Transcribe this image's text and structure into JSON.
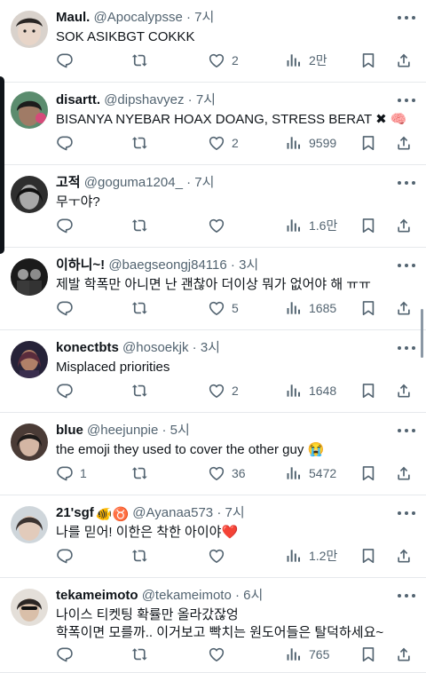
{
  "tweets": [
    {
      "name": "Maul.",
      "handle": "@Apocalypsse",
      "sep": "·",
      "time": "7시",
      "text": [
        "SOK ASIKBGT COKKK"
      ],
      "emoji": "",
      "counts": {
        "reply": "",
        "retweet": "",
        "like": "2",
        "views": "2만"
      }
    },
    {
      "name": "disartt.",
      "handle": "@dipshavyez",
      "sep": "·",
      "time": "7시",
      "text": [
        "BISANYA NYEBAR HOAX DOANG, STRESS BERAT ✖ 🧠"
      ],
      "emoji": "",
      "counts": {
        "reply": "",
        "retweet": "",
        "like": "2",
        "views": "9599"
      }
    },
    {
      "name": "고적",
      "handle": "@goguma1204_",
      "sep": "·",
      "time": "7시",
      "text": [
        "무ㅜ야?"
      ],
      "emoji": "",
      "counts": {
        "reply": "",
        "retweet": "",
        "like": "",
        "views": "1.6만"
      }
    },
    {
      "name": "이하니~!",
      "handle": "@baegseongj84116",
      "sep": "·",
      "time": "3시",
      "text": [
        "제발 학폭만 아니면 난 괜찮아 더이상 뭐가 없어야 해 ㅠㅠ"
      ],
      "emoji": "",
      "counts": {
        "reply": "",
        "retweet": "",
        "like": "5",
        "views": "1685"
      }
    },
    {
      "name": "konectbts",
      "handle": "@hosoekjk",
      "sep": "·",
      "time": "3시",
      "text": [
        "Misplaced priorities"
      ],
      "emoji": "",
      "counts": {
        "reply": "",
        "retweet": "",
        "like": "2",
        "views": "1648"
      }
    },
    {
      "name": "blue",
      "handle": "@heejunpie",
      "sep": "·",
      "time": "5시",
      "text": [
        "the emoji they used to cover the other guy 😭"
      ],
      "emoji": "",
      "counts": {
        "reply": "1",
        "retweet": "",
        "like": "36",
        "views": "5472"
      }
    },
    {
      "name": "21'sgf",
      "handle": "@Ayanaa573",
      "sep": "·",
      "time": "7시",
      "text": [
        "나를 믿어! 이한은 착한 아이야❤️"
      ],
      "emoji": "🐠♉",
      "counts": {
        "reply": "",
        "retweet": "",
        "like": "",
        "views": "1.2만"
      }
    },
    {
      "name": "tekameimoto",
      "handle": "@tekameimoto",
      "sep": "·",
      "time": "6시",
      "text": [
        "나이스 티켓팅 확률만 올라갔잖엉",
        "학폭이면 모를까.. 이거보고 빡치는 원도어들은 탈덕하세요~"
      ],
      "emoji": "",
      "counts": {
        "reply": "",
        "retweet": "",
        "like": "",
        "views": "765"
      }
    }
  ],
  "icons": {
    "reply": "reply-icon",
    "retweet": "retweet-icon",
    "like": "heart-icon",
    "views": "views-icon",
    "bookmark": "bookmark-icon",
    "share": "share-icon",
    "more": "more-icon"
  },
  "colors": {
    "text": "#0f1419",
    "muted": "#536471",
    "divider": "#e6e9ec"
  }
}
